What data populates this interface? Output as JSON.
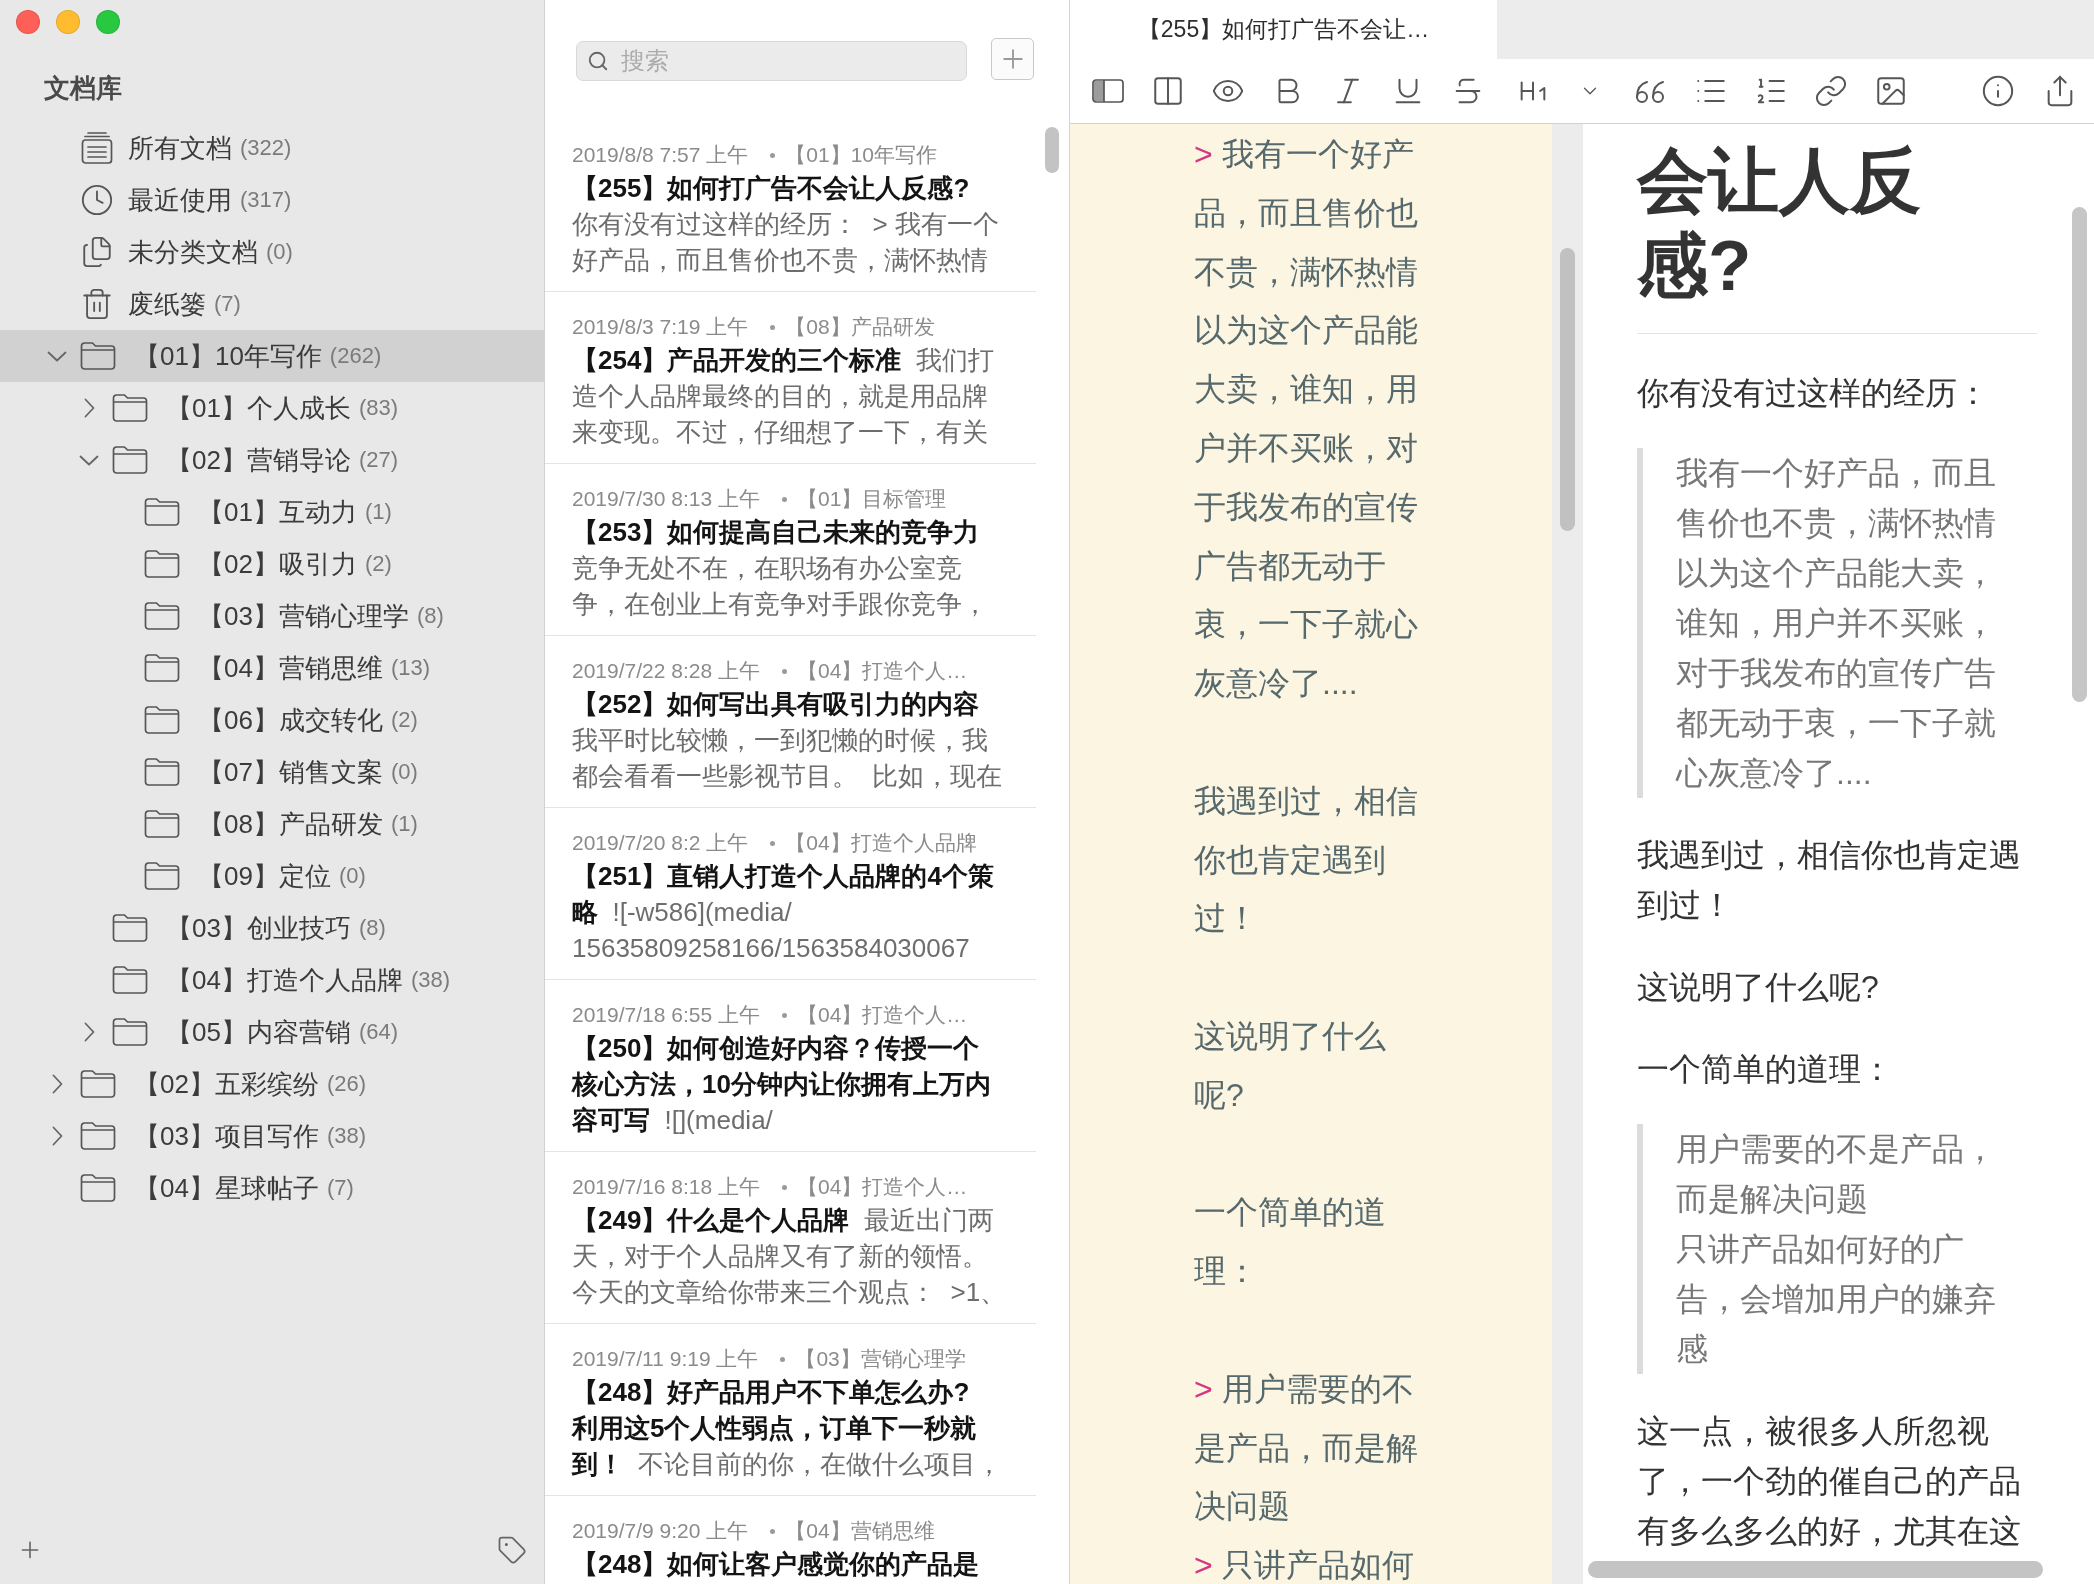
{
  "sidebar": {
    "title": "文档库",
    "items": [
      {
        "kind": "all",
        "label": "所有文档",
        "count": "(322)",
        "selected": false
      },
      {
        "kind": "recent",
        "label": "最近使用",
        "count": "(317)",
        "selected": false
      },
      {
        "kind": "unfiled",
        "label": "未分类文档",
        "count": "(0)",
        "selected": false
      },
      {
        "kind": "trash",
        "label": "废纸篓",
        "count": "(7)",
        "selected": false
      },
      {
        "kind": "folder",
        "label": "【01】10年写作",
        "count": "(262)",
        "selected": true,
        "expanded": true,
        "children": [
          {
            "kind": "folder",
            "label": "【01】个人成长",
            "count": "(83)",
            "selected": false,
            "expanded": false
          },
          {
            "kind": "folder",
            "label": "【02】营销导论",
            "count": "(27)",
            "selected": false,
            "expanded": true,
            "children": [
              {
                "kind": "folder",
                "label": "【01】互动力",
                "count": "(1)",
                "selected": false
              },
              {
                "kind": "folder",
                "label": "【02】吸引力",
                "count": "(2)",
                "selected": false
              },
              {
                "kind": "folder",
                "label": "【03】营销心理学",
                "count": "(8)",
                "selected": false
              },
              {
                "kind": "folder",
                "label": "【04】营销思维",
                "count": "(13)",
                "selected": false
              },
              {
                "kind": "folder",
                "label": "【06】成交转化",
                "count": "(2)",
                "selected": false
              },
              {
                "kind": "folder",
                "label": "【07】销售文案",
                "count": "(0)",
                "selected": false
              },
              {
                "kind": "folder",
                "label": "【08】产品研发",
                "count": "(1)",
                "selected": false
              },
              {
                "kind": "folder",
                "label": "【09】定位",
                "count": "(0)",
                "selected": false
              }
            ]
          },
          {
            "kind": "folder",
            "label": "【03】创业技巧",
            "count": "(8)",
            "selected": false
          },
          {
            "kind": "folder",
            "label": "【04】打造个人品牌",
            "count": "(38)",
            "selected": false
          },
          {
            "kind": "folder",
            "label": "【05】内容营销",
            "count": "(64)",
            "selected": false,
            "expanded": false
          }
        ]
      },
      {
        "kind": "folder",
        "label": "【02】五彩缤纷",
        "count": "(26)",
        "selected": false,
        "expanded": false
      },
      {
        "kind": "folder",
        "label": "【03】项目写作",
        "count": "(38)",
        "selected": false,
        "expanded": false
      },
      {
        "kind": "folder",
        "label": "【04】星球帖子",
        "count": "(7)",
        "selected": false
      }
    ]
  },
  "note_list": {
    "search": {
      "placeholder": "搜索"
    },
    "notes": [
      {
        "date": "2019/8/8 7:57 上午",
        "folder": "【01】10年写作",
        "lines": [
          "**【255】如何打广告不会让人反感?**",
          "你有没有过这样的经历：  > 我有一个",
          "好产品，而且售价也不贵，满怀热情"
        ]
      },
      {
        "date": "2019/8/3 7:19 上午",
        "folder": "【08】产品研发",
        "lines": [
          "**【254】产品开发的三个标准**  我们打",
          "造个人品牌最终的目的，就是用品牌",
          "来变现。不过，仔细想了一下，有关"
        ]
      },
      {
        "date": "2019/7/30 8:13 上午",
        "folder": "【01】目标管理",
        "lines": [
          "**【253】如何提高自己未来的竞争力**",
          "竞争无处不在，在职场有办公室竞",
          "争，在创业上有竞争对手跟你竞争，"
        ]
      },
      {
        "date": "2019/7/22 8:28 上午",
        "folder": "【04】打造个人…",
        "lines": [
          "**【252】如何写出具有吸引力的内容**",
          "我平时比较懒，一到犯懒的时候，我",
          "都会看看一些影视节目。  比如，现在"
        ]
      },
      {
        "date": "2019/7/20 8:2 上午",
        "folder": "【04】打造个人品牌",
        "lines": [
          "**【251】直销人打造个人品牌的4个策**",
          "**略**  ![-w586](media/",
          "15635809258166/1563584030067"
        ]
      },
      {
        "date": "2019/7/18 6:55 上午",
        "folder": "【04】打造个人…",
        "lines": [
          "**【250】如何创造好内容？传授一个**",
          "**核心方法，10分钟内让你拥有上万内**",
          "**容可写**  ![](media/"
        ]
      },
      {
        "date": "2019/7/16 8:18 上午",
        "folder": "【04】打造个人…",
        "lines": [
          "**【249】什么是个人品牌**  最近出门两",
          "天，对于个人品牌又有了新的领悟。",
          "今天的文章给你带来三个观点：  >1、"
        ]
      },
      {
        "date": "2019/7/11 9:19 上午",
        "folder": "【03】营销心理学",
        "lines": [
          "**【248】好产品用户不下单怎么办?**",
          "**利用这5个人性弱点，订单下一秒就**",
          "**到！**  不论目前的你，在做什么项目，"
        ]
      },
      {
        "date": "2019/7/9 9:20 上午",
        "folder": "【04】营销思维",
        "lines": [
          "**【248】如何让客户感觉你的产品是**"
        ]
      }
    ]
  },
  "editor": {
    "tabs": [
      {
        "title": "【255】如何打广告不会让…",
        "selected": true
      }
    ],
    "source": [
      {
        "kind": "quote",
        "lines": [
          {
            "marker": ">",
            "text": "我有一个好产品，而且售价也不贵，满怀热情以为这个产品能大卖，谁知，用户并不买账，对于我发布的宣传广告都无动于衷，一下子就心灰意冷了...."
          }
        ]
      },
      {
        "kind": "paragraph",
        "text": "我遇到过，相信你也肯定遇到过！"
      },
      {
        "kind": "paragraph",
        "text": "这说明了什么呢?"
      },
      {
        "kind": "paragraph",
        "text": "一个简单的道理："
      },
      {
        "kind": "quote",
        "lines": [
          {
            "marker": ">",
            "text": "用户需要的不是产品，而是解决问题"
          },
          {
            "marker": ">",
            "text": "只讲产品如何"
          }
        ]
      }
    ],
    "preview": [
      {
        "kind": "heading",
        "text": "会让人反感?"
      },
      {
        "kind": "rule"
      },
      {
        "kind": "paragraph",
        "text": "你有没有过这样的经历："
      },
      {
        "kind": "quote",
        "lines": [
          "我有一个好产品，而且售价也不贵，满怀热情以为这个产品能大卖，谁知，用户并不买账，对于我发布的宣传广告都无动于衷，一下子就心灰意冷了...."
        ]
      },
      {
        "kind": "paragraph",
        "text": "我遇到过，相信你也肯定遇到过！"
      },
      {
        "kind": "paragraph",
        "text": "这说明了什么呢?"
      },
      {
        "kind": "paragraph",
        "text": "一个简单的道理："
      },
      {
        "kind": "quote",
        "lines": [
          "用户需要的不是产品，而是解决问题",
          "只讲产品如何好的广告，会增加用户的嫌弃感"
        ]
      },
      {
        "kind": "paragraph",
        "text": "这一点，被很多人所忽视了，一个劲的催自己的产品有多么多么的好，尤其在这"
      }
    ]
  }
}
